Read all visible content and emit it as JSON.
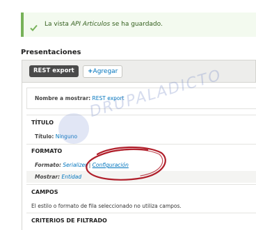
{
  "status": {
    "prefix": "La vista",
    "view_name": "API Articulos",
    "suffix": "se ha guardado."
  },
  "section_title": "Presentaciones",
  "tabs": {
    "active": "REST export",
    "add_label": "Agregar",
    "add_icon": "+"
  },
  "display_name": {
    "label": "Nombre a mostrar:",
    "value": "REST export"
  },
  "titulo": {
    "heading": "TÍTULO",
    "label": "Título:",
    "value": "Ninguno"
  },
  "formato": {
    "heading": "FORMATO",
    "label": "Formato:",
    "value": "Serializer",
    "separator": "|",
    "config_link": "Configuración",
    "show_label": "Mostrar:",
    "show_value": "Entidad"
  },
  "campos": {
    "heading": "CAMPOS",
    "note": "El estilo o formato de fila seleccionado no utiliza campos."
  },
  "criterios": {
    "heading": "CRITERIOS DE FILTRADO"
  },
  "watermark": "DRUPALADICTO",
  "colors": {
    "status_border": "#77b259",
    "status_bg": "#f3faef",
    "link": "#0074bd",
    "highlight_circle": "#b01e2a"
  },
  "icons": {
    "status": "check-icon",
    "add": "plus-icon"
  }
}
